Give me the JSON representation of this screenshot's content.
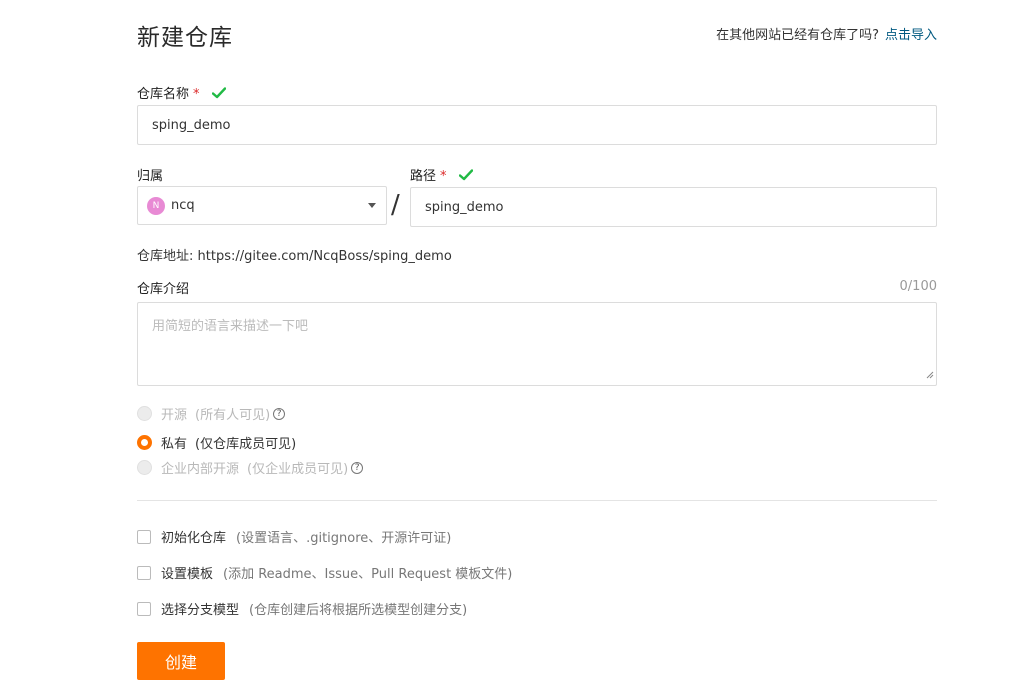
{
  "header": {
    "title": "新建仓库",
    "import_hint": "在其他网站已经有仓库了吗?",
    "import_link": "点击导入"
  },
  "repo_name": {
    "label": "仓库名称",
    "required_mark": "*",
    "value": "sping_demo"
  },
  "owner": {
    "label": "归属",
    "avatar_letter": "N",
    "value": "ncq"
  },
  "separator": "/",
  "path": {
    "label": "路径",
    "required_mark": "*",
    "value": "sping_demo"
  },
  "repo_address": {
    "label": "仓库地址:",
    "value": "https://gitee.com/NcqBoss/sping_demo"
  },
  "description": {
    "label": "仓库介绍",
    "counter": "0/100",
    "placeholder": "用简短的语言来描述一下吧"
  },
  "visibility": [
    {
      "label": "开源",
      "desc": "(所有人可见)",
      "checked": false,
      "disabled": true,
      "help": true
    },
    {
      "label": "私有",
      "desc": "(仅仓库成员可见)",
      "checked": true,
      "disabled": false,
      "help": false
    },
    {
      "label": "企业内部开源",
      "desc": "(仅企业成员可见)",
      "checked": false,
      "disabled": true,
      "help": true
    }
  ],
  "options": [
    {
      "label": "初始化仓库",
      "desc": "(设置语言、.gitignore、开源许可证)"
    },
    {
      "label": "设置模板",
      "desc": "(添加 Readme、Issue、Pull Request 模板文件)"
    },
    {
      "label": "选择分支模型",
      "desc": "(仓库创建后将根据所选模型创建分支)"
    }
  ],
  "create_button": "创建",
  "colors": {
    "accent": "#fe7300",
    "link": "#005980",
    "success": "#21ba45",
    "required": "#db2828"
  }
}
